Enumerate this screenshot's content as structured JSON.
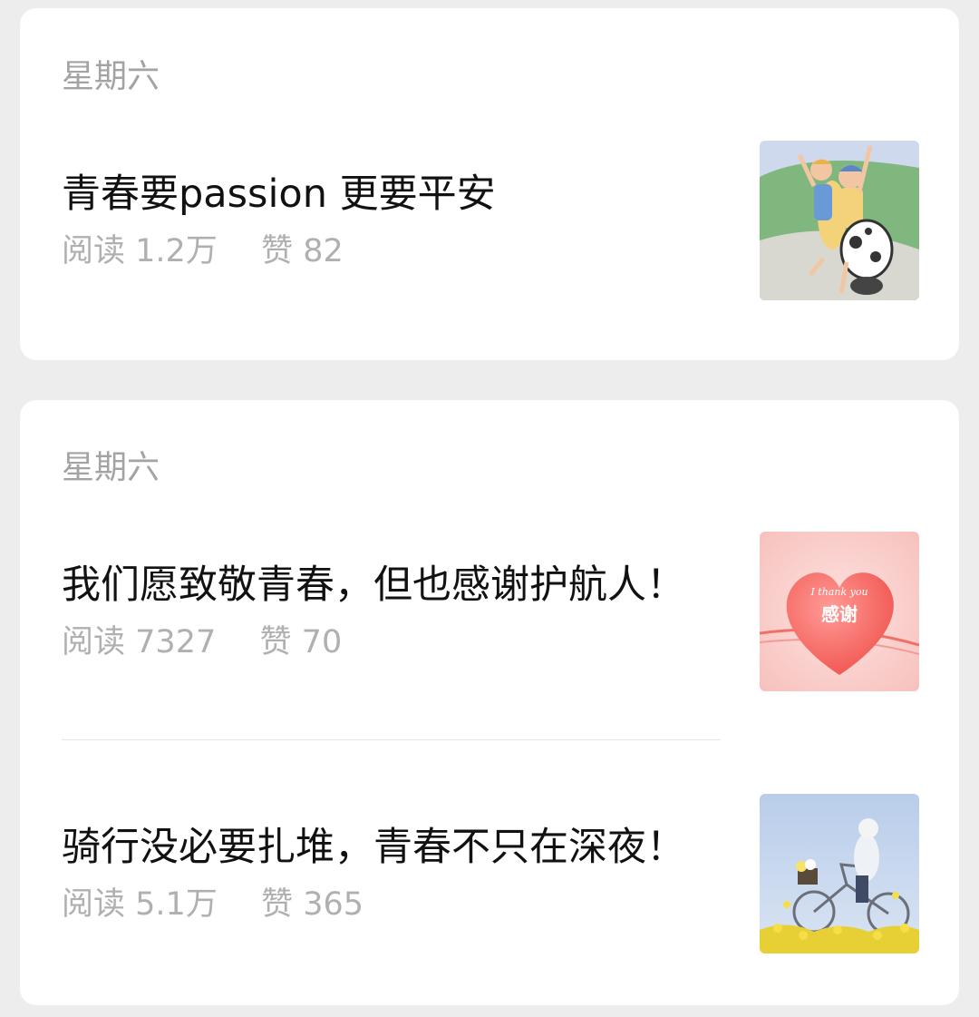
{
  "cards": [
    {
      "date": "星期六",
      "articles": [
        {
          "title": "青春要passion  更要平安",
          "read_label": "阅读",
          "read_count": "1.2万",
          "like_label": "赞",
          "like_count": "82",
          "thumbnail": "cartoon-couple-scooter-illustration"
        }
      ]
    },
    {
      "date": "星期六",
      "articles": [
        {
          "title": "我们愿致敬青春，但也感谢护航人！",
          "read_label": "阅读",
          "read_count": "7327",
          "like_label": "赞",
          "like_count": "70",
          "thumbnail": "pink-heart-thank-you-image",
          "thumb_text": "感谢",
          "thumb_script": "I thank you"
        },
        {
          "title": "骑行没必要扎堆，青春不只在深夜！",
          "read_label": "阅读",
          "read_count": "5.1万",
          "like_label": "赞",
          "like_count": "365",
          "thumbnail": "girl-riding-bicycle-flowers-photo"
        }
      ]
    }
  ]
}
